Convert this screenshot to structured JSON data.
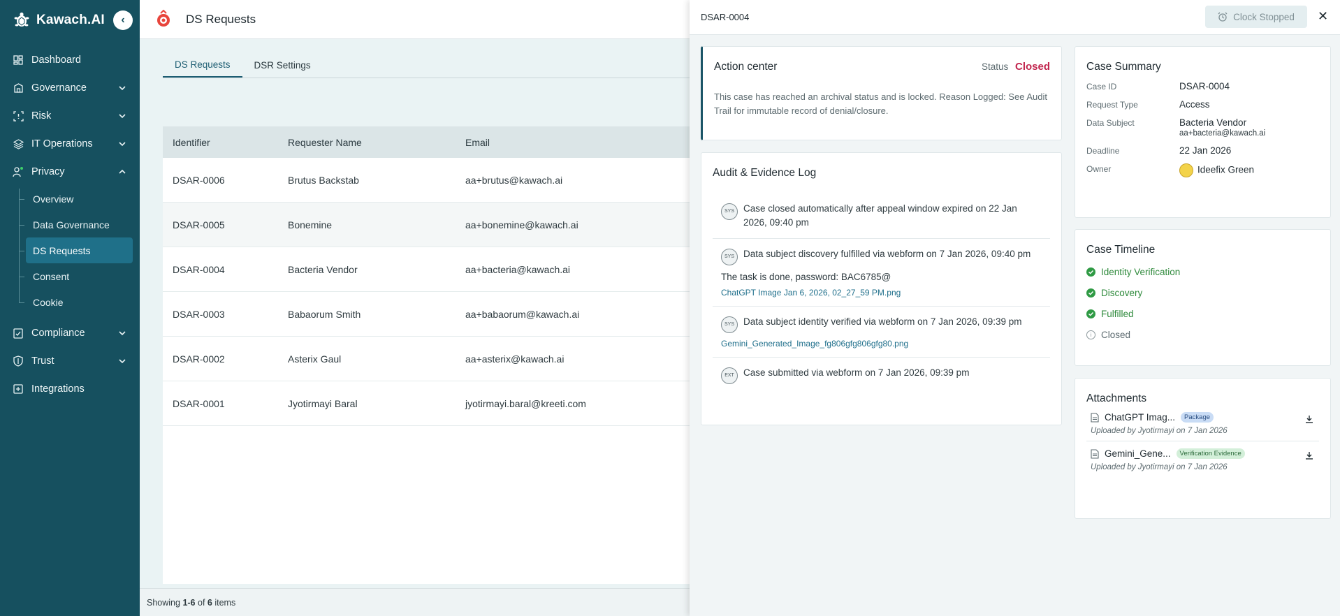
{
  "sidebar": {
    "brand": "Kawach.AI",
    "items": [
      {
        "label": "Dashboard"
      },
      {
        "label": "Governance"
      },
      {
        "label": "Risk"
      },
      {
        "label": "IT Operations"
      },
      {
        "label": "Privacy"
      },
      {
        "label": "Compliance"
      },
      {
        "label": "Trust"
      },
      {
        "label": "Integrations"
      }
    ],
    "privacy_sub": [
      {
        "label": "Overview"
      },
      {
        "label": "Data Governance"
      },
      {
        "label": "DS Requests"
      },
      {
        "label": "Consent"
      },
      {
        "label": "Cookie"
      }
    ]
  },
  "header": {
    "title": "DS Requests"
  },
  "tabs": [
    {
      "label": "DS Requests"
    },
    {
      "label": "DSR Settings"
    }
  ],
  "table": {
    "columns": [
      "Identifier",
      "Requester Name",
      "Email"
    ],
    "rows": [
      {
        "id": "DSAR-0006",
        "name": "Brutus Backstab",
        "email": "aa+brutus@kawach.ai"
      },
      {
        "id": "DSAR-0005",
        "name": "Bonemine",
        "email": "aa+bonemine@kawach.ai"
      },
      {
        "id": "DSAR-0004",
        "name": "Bacteria Vendor",
        "email": "aa+bacteria@kawach.ai"
      },
      {
        "id": "DSAR-0003",
        "name": "Babaorum Smith",
        "email": "aa+babaorum@kawach.ai"
      },
      {
        "id": "DSAR-0002",
        "name": "Asterix Gaul",
        "email": "aa+asterix@kawach.ai"
      },
      {
        "id": "DSAR-0001",
        "name": "Jyotirmayi Baral",
        "email": "jyotirmayi.baral@kreeti.com"
      }
    ]
  },
  "footer": {
    "prefix": "Showing ",
    "range": "1-6",
    "of": " of ",
    "total": "6",
    "suffix": " items"
  },
  "drawer": {
    "id": "DSAR-0004",
    "clock_label": "Clock Stopped",
    "action": {
      "title": "Action center",
      "status_label": "Status",
      "status_value": "Closed",
      "status_color": "#c2274f",
      "text": "This case has reached an archival status and is locked. Reason Logged: See Audit Trail for immutable record of denial/closure."
    },
    "audit": {
      "title": "Audit & Evidence Log",
      "items": [
        {
          "tag": "SYS",
          "text": "Case closed automatically after appeal window expired on 22 Jan 2026, 09:40 pm"
        },
        {
          "tag": "SYS",
          "text": "Data subject discovery fulfilled via webform on 7 Jan 2026, 09:40 pm",
          "note": "The task is done, password: BAC6785@",
          "link": "ChatGPT Image Jan 6, 2026, 02_27_59 PM.png"
        },
        {
          "tag": "SYS",
          "text": "Data subject identity verified via webform on 7 Jan 2026, 09:39 pm",
          "link": "Gemini_Generated_Image_fg806gfg806gfg80.png"
        },
        {
          "tag": "EXT",
          "text": "Case submitted via webform on 7 Jan 2026, 09:39 pm"
        }
      ]
    },
    "summary": {
      "title": "Case Summary",
      "case_id_label": "Case ID",
      "case_id": "DSAR-0004",
      "request_type_label": "Request Type",
      "request_type": "Access",
      "data_subject_label": "Data Subject",
      "data_subject": "Bacteria Vendor",
      "data_subject_email": "aa+bacteria@kawach.ai",
      "deadline_label": "Deadline",
      "deadline": "22 Jan 2026",
      "owner_label": "Owner",
      "owner": "Ideefix Green"
    },
    "timeline": {
      "title": "Case Timeline",
      "steps": [
        {
          "label": "Identity Verification",
          "done": true
        },
        {
          "label": "Discovery",
          "done": true
        },
        {
          "label": "Fulfilled",
          "done": true
        },
        {
          "label": "Closed",
          "done": false
        }
      ]
    },
    "attachments": {
      "title": "Attachments",
      "items": [
        {
          "name": "ChatGPT Imag...",
          "badge": "Package",
          "uploaded": "Uploaded by Jyotirmayi on 7 Jan 2026"
        },
        {
          "name": "Gemini_Gene...",
          "badge": "Verification Evidence",
          "uploaded": "Uploaded by Jyotirmayi on 7 Jan 2026"
        }
      ]
    }
  },
  "colors": {
    "sidebar_bg": "#16505f",
    "accent": "#1d5d72",
    "status_closed": "#c2274f",
    "timeline_done": "#2f9a44"
  }
}
